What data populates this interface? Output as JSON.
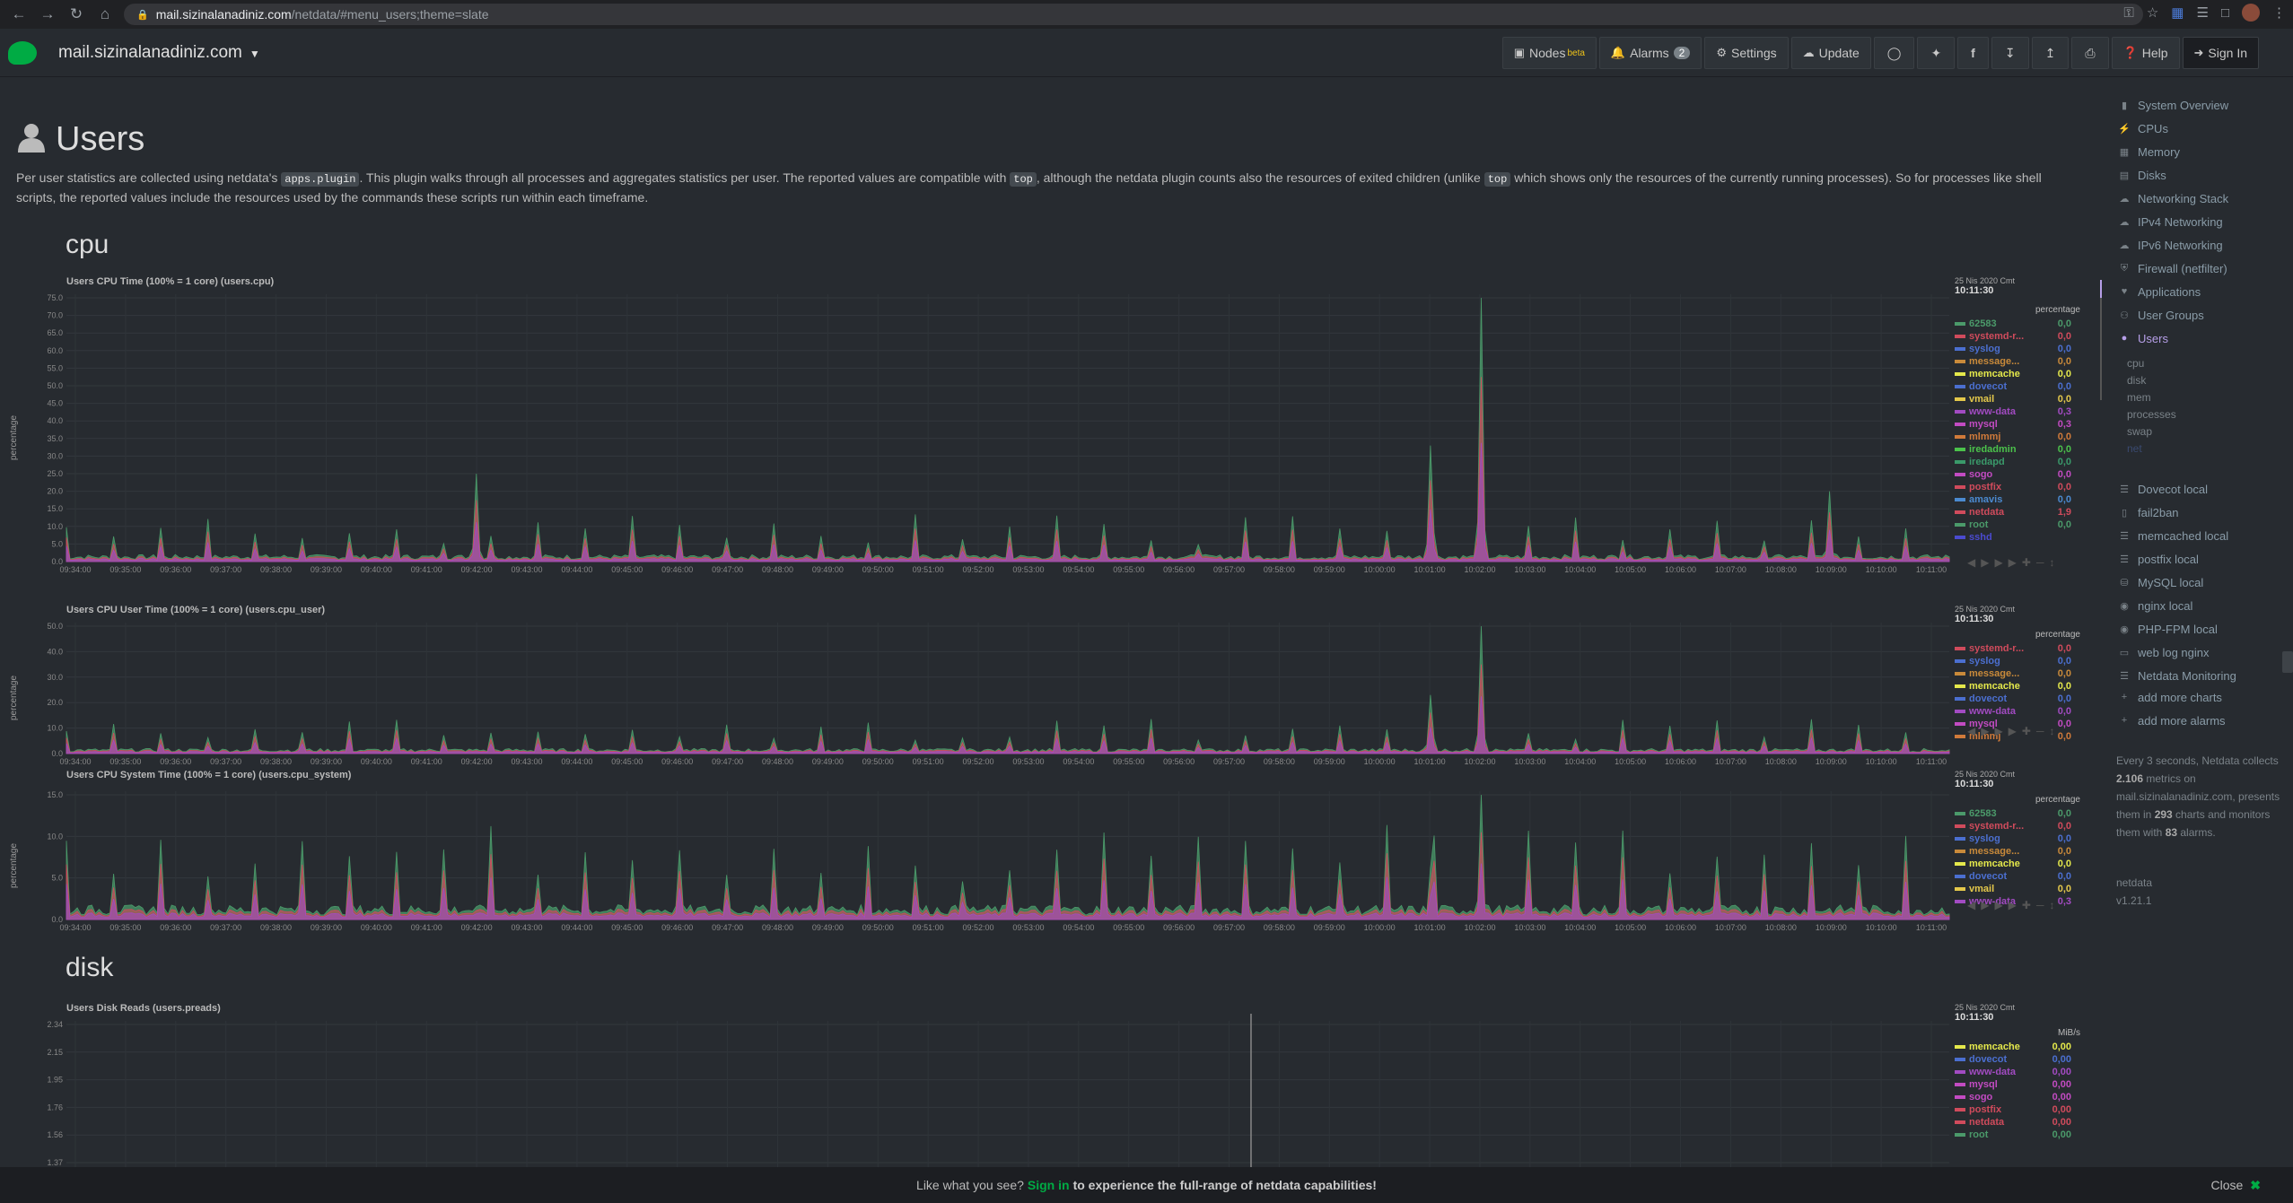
{
  "browser": {
    "url_host": "mail.sizinalanadiniz.com",
    "url_path": "/netdata/#menu_users;theme=slate"
  },
  "navbar": {
    "hostname": "mail.sizinalanadiniz.com",
    "nodes_label": "Nodes",
    "nodes_beta": "beta",
    "alarms_label": "Alarms",
    "alarms_count": "2",
    "settings_label": "Settings",
    "update_label": "Update",
    "help_label": "Help",
    "signin_label": "Sign In"
  },
  "page": {
    "title": "Users",
    "intro_1": "Per user statistics are collected using netdata's ",
    "intro_code1": "apps.plugin",
    "intro_2": ". This plugin walks through all processes and aggregates statistics per user. The reported values are compatible with ",
    "intro_code2": "top",
    "intro_3": ", although the netdata plugin counts also the resources of exited children (unlike ",
    "intro_code3": "top",
    "intro_4": " which shows only the resources of the currently running processes). So for processes like shell scripts, the reported values include the resources used by the commands these scripts run within each timeframe.",
    "section_cpu": "cpu",
    "section_disk": "disk"
  },
  "colors": {
    "accent_green": "#00ab44",
    "active_purple": "#b69fe8",
    "chart_green": "#4b9a6a",
    "chart_red": "#d04b5c",
    "chart_purple": "#a24bc2"
  },
  "chart_data": [
    {
      "type": "area",
      "title": "Users CPU Time (100% = 1 core) (users.cpu)",
      "ylabel": "percentage",
      "yticks": [
        "75.0",
        "70.0",
        "65.0",
        "60.0",
        "55.0",
        "50.0",
        "45.0",
        "40.0",
        "35.0",
        "30.0",
        "25.0",
        "20.0",
        "15.0",
        "10.0",
        "5.0",
        "0.0"
      ],
      "ylim": [
        0,
        75
      ],
      "xticks": [
        "09:34:00",
        "09:35:00",
        "09:36:00",
        "09:37:00",
        "09:38:00",
        "09:39:00",
        "09:40:00",
        "09:41:00",
        "09:42:00",
        "09:43:00",
        "09:44:00",
        "09:45:00",
        "09:46:00",
        "09:47:00",
        "09:48:00",
        "09:49:00",
        "09:50:00",
        "09:51:00",
        "09:52:00",
        "09:53:00",
        "09:54:00",
        "09:55:00",
        "09:56:00",
        "09:57:00",
        "09:58:00",
        "09:59:00",
        "10:00:00",
        "10:01:00",
        "10:02:00",
        "10:03:00",
        "10:04:00",
        "10:05:00",
        "10:06:00",
        "10:07:00",
        "10:08:00",
        "10:09:00",
        "10:10:00",
        "10:11:00"
      ],
      "spikes": [
        {
          "x": "10:02:00",
          "y": 75
        },
        {
          "x": "10:01:00",
          "y": 33
        },
        {
          "x": "09:42:00",
          "y": 25
        },
        {
          "x": "10:09:00",
          "y": 20
        }
      ],
      "legend_date": "25 Nis 2020 Cmt",
      "legend_time": "10:11:30",
      "unit": "percentage",
      "series": [
        {
          "name": "62583",
          "value": "0,0",
          "color": "#4b9a6a"
        },
        {
          "name": "systemd-r...",
          "value": "0,0",
          "color": "#d04b5c"
        },
        {
          "name": "syslog",
          "value": "0,0",
          "color": "#4b6fd0"
        },
        {
          "name": "message...",
          "value": "0,0",
          "color": "#c98a3a"
        },
        {
          "name": "memcache",
          "value": "0,0",
          "color": "#e4e84b"
        },
        {
          "name": "dovecot",
          "value": "0,0",
          "color": "#4b6fd0"
        },
        {
          "name": "vmail",
          "value": "0,0",
          "color": "#e4c84b"
        },
        {
          "name": "www-data",
          "value": "0,3",
          "color": "#a24bc2"
        },
        {
          "name": "mysql",
          "value": "0,3",
          "color": "#c24bc2"
        },
        {
          "name": "mlmmj",
          "value": "0,0",
          "color": "#d07a3a"
        },
        {
          "name": "iredadmin",
          "value": "0,0",
          "color": "#4bc24b"
        },
        {
          "name": "iredapd",
          "value": "0,0",
          "color": "#3a9a6a"
        },
        {
          "name": "sogo",
          "value": "0,0",
          "color": "#c24bc2"
        },
        {
          "name": "postfix",
          "value": "0,0",
          "color": "#d04b5c"
        },
        {
          "name": "amavis",
          "value": "0,0",
          "color": "#4b8ad0"
        },
        {
          "name": "netdata",
          "value": "1,9",
          "color": "#d04b5c"
        },
        {
          "name": "root",
          "value": "0,0",
          "color": "#4b9a6a"
        },
        {
          "name": "sshd",
          "value": "",
          "color": "#4b4bd0"
        }
      ]
    },
    {
      "type": "area",
      "title": "Users CPU User Time (100% = 1 core) (users.cpu_user)",
      "ylabel": "percentage",
      "yticks": [
        "50.0",
        "40.0",
        "30.0",
        "20.0",
        "10.0",
        "0.0"
      ],
      "ylim": [
        0,
        50
      ],
      "spikes": [
        {
          "x": "10:02:00",
          "y": 50
        },
        {
          "x": "10:01:00",
          "y": 23
        }
      ],
      "legend_date": "25 Nis 2020 Cmt",
      "legend_time": "10:11:30",
      "unit": "percentage",
      "series": [
        {
          "name": "systemd-r...",
          "value": "0,0",
          "color": "#d04b5c"
        },
        {
          "name": "syslog",
          "value": "0,0",
          "color": "#4b6fd0"
        },
        {
          "name": "message...",
          "value": "0,0",
          "color": "#c98a3a"
        },
        {
          "name": "memcache",
          "value": "0,0",
          "color": "#e4e84b"
        },
        {
          "name": "dovecot",
          "value": "0,0",
          "color": "#4b6fd0"
        },
        {
          "name": "www-data",
          "value": "0,0",
          "color": "#a24bc2"
        },
        {
          "name": "mysql",
          "value": "0,0",
          "color": "#c24bc2"
        },
        {
          "name": "mlmmj",
          "value": "0,0",
          "color": "#d07a3a"
        }
      ]
    },
    {
      "type": "area",
      "title": "Users CPU System Time (100% = 1 core) (users.cpu_system)",
      "ylabel": "percentage",
      "yticks": [
        "15.0",
        "10.0",
        "5.0",
        "0.0"
      ],
      "ylim": [
        0,
        17
      ],
      "spikes": [
        {
          "x": "10:02:00",
          "y": 17
        },
        {
          "x": "10:01:00",
          "y": 7
        }
      ],
      "legend_date": "25 Nis 2020 Cmt",
      "legend_time": "10:11:30",
      "unit": "percentage",
      "series": [
        {
          "name": "62583",
          "value": "0,0",
          "color": "#4b9a6a"
        },
        {
          "name": "systemd-r...",
          "value": "0,0",
          "color": "#d04b5c"
        },
        {
          "name": "syslog",
          "value": "0,0",
          "color": "#4b6fd0"
        },
        {
          "name": "message...",
          "value": "0,0",
          "color": "#c98a3a"
        },
        {
          "name": "memcache",
          "value": "0,0",
          "color": "#e4e84b"
        },
        {
          "name": "dovecot",
          "value": "0,0",
          "color": "#4b6fd0"
        },
        {
          "name": "vmail",
          "value": "0,0",
          "color": "#e4c84b"
        },
        {
          "name": "www-data",
          "value": "0,3",
          "color": "#a24bc2"
        }
      ]
    },
    {
      "type": "area",
      "title": "Users Disk Reads (users.preads)",
      "ylabel": "",
      "yticks": [
        "2.34",
        "2.15",
        "1.95",
        "1.76",
        "1.56",
        "1.37"
      ],
      "legend_date": "25 Nis 2020 Cmt",
      "legend_time": "10:11:30",
      "unit": "MiB/s",
      "series": [
        {
          "name": "memcache",
          "value": "0,00",
          "color": "#e4e84b"
        },
        {
          "name": "dovecot",
          "value": "0,00",
          "color": "#4b6fd0"
        },
        {
          "name": "www-data",
          "value": "0,00",
          "color": "#a24bc2"
        },
        {
          "name": "mysql",
          "value": "0,00",
          "color": "#c24bc2"
        },
        {
          "name": "sogo",
          "value": "0,00",
          "color": "#c24bc2"
        },
        {
          "name": "postfix",
          "value": "0,00",
          "color": "#d04b5c"
        },
        {
          "name": "netdata",
          "value": "0,00",
          "color": "#d04b5c"
        },
        {
          "name": "root",
          "value": "0,00",
          "color": "#4b9a6a"
        }
      ]
    }
  ],
  "sidebar": {
    "items": [
      {
        "label": "System Overview",
        "icon": "bookmark-icon"
      },
      {
        "label": "CPUs",
        "icon": "bolt-icon"
      },
      {
        "label": "Memory",
        "icon": "memory-icon"
      },
      {
        "label": "Disks",
        "icon": "hdd-icon"
      },
      {
        "label": "Networking Stack",
        "icon": "cloud-icon"
      },
      {
        "label": "IPv4 Networking",
        "icon": "cloud-icon"
      },
      {
        "label": "IPv6 Networking",
        "icon": "cloud-icon"
      },
      {
        "label": "Firewall (netfilter)",
        "icon": "shield-icon"
      },
      {
        "label": "Applications",
        "icon": "heartbeat-icon"
      },
      {
        "label": "User Groups",
        "icon": "users-icon"
      },
      {
        "label": "Users",
        "icon": "user-icon"
      }
    ],
    "user_subitems": [
      "cpu",
      "disk",
      "mem",
      "processes",
      "swap",
      "net"
    ],
    "services": [
      {
        "label": "Dovecot local",
        "icon": "server-icon"
      },
      {
        "label": "fail2ban",
        "icon": "folder-icon"
      },
      {
        "label": "memcached local",
        "icon": "server-icon"
      },
      {
        "label": "postfix local",
        "icon": "server-icon"
      },
      {
        "label": "MySQL local",
        "icon": "database-icon"
      },
      {
        "label": "nginx local",
        "icon": "eye-icon"
      },
      {
        "label": "PHP-FPM local",
        "icon": "eye-icon"
      },
      {
        "label": "web log nginx",
        "icon": "file-icon"
      },
      {
        "label": "Netdata Monitoring",
        "icon": "server-icon"
      }
    ],
    "add_charts": "add more charts",
    "add_alarms": "add more alarms",
    "footer_1": "Every 3 seconds, Netdata collects ",
    "footer_metrics": "2.106",
    "footer_2": " metrics on mail.sizinalanadiniz.com, presents them in ",
    "footer_charts": "293",
    "footer_3": " charts and monitors them with ",
    "footer_alarms": "83",
    "footer_4": " alarms.",
    "product": "netdata",
    "version": "v1.21.1"
  },
  "banner": {
    "prefix": "Like what you see?",
    "signin": "Sign in",
    "rest": "to experience the full-range of netdata capabilities!",
    "close": "Close"
  }
}
